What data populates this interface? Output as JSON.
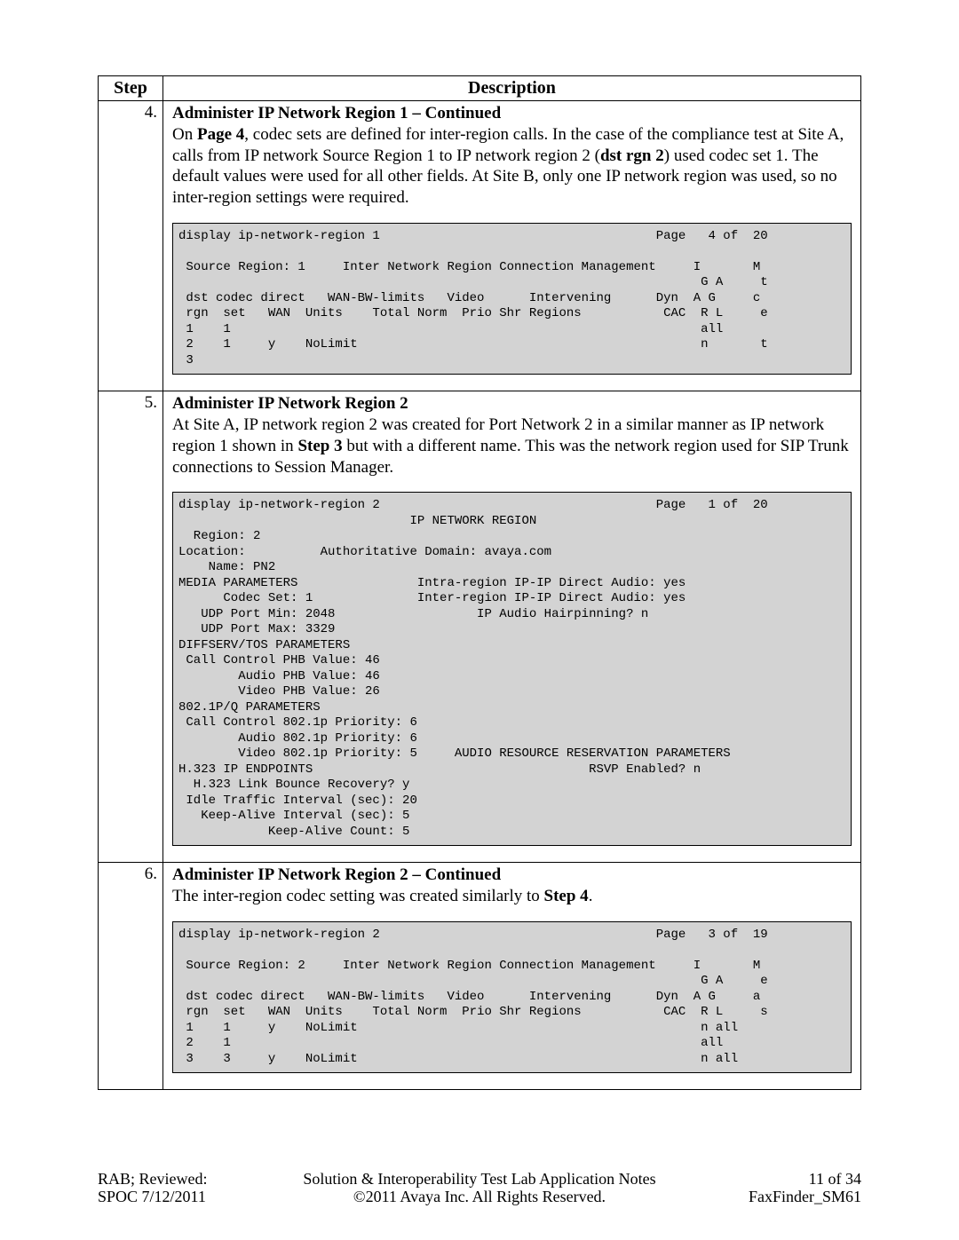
{
  "table": {
    "headers": {
      "step": "Step",
      "description": "Description"
    },
    "rows": [
      {
        "step": "4.",
        "title": "Administer IP Network Region 1 – Continued",
        "para_on": "On ",
        "para_page4": "Page 4",
        "para_mid1": ", codec sets are defined for inter-region calls. In the case of the compliance test at Site A, calls from IP network Source Region 1 to IP network region 2 (",
        "para_dstrgn": "dst rgn 2",
        "para_mid2": ") used codec set 1. The default values were used for all other fields. At Site B, only one IP network region was used, so no inter-region settings were required.",
        "code": "display ip-network-region 1                                     Page   4 of  20\n\n Source Region: 1     Inter Network Region Connection Management     I       M\n                                                                      G A     t\n dst codec direct   WAN-BW-limits   Video      Intervening      Dyn  A G     c\n rgn  set   WAN  Units    Total Norm  Prio Shr Regions           CAC  R L     e\n 1    1                                                               all\n 2    1     y    NoLimit                                              n       t\n 3"
      },
      {
        "step": "5.",
        "title": "Administer IP Network Region 2",
        "para_pre": "At Site A, IP network region 2 was created for Port Network 2 in a similar manner as IP network region 1 shown in ",
        "para_step3": "Step 3",
        "para_post": " but with a different name. This was the network region used for SIP Trunk connections to Session Manager.",
        "code": "display ip-network-region 2                                     Page   1 of  20\n                               IP NETWORK REGION\n  Region: 2\nLocation:          Authoritative Domain: avaya.com\n    Name: PN2\nMEDIA PARAMETERS                Intra-region IP-IP Direct Audio: yes\n      Codec Set: 1              Inter-region IP-IP Direct Audio: yes\n   UDP Port Min: 2048                   IP Audio Hairpinning? n\n   UDP Port Max: 3329\nDIFFSERV/TOS PARAMETERS\n Call Control PHB Value: 46\n        Audio PHB Value: 46\n        Video PHB Value: 26\n802.1P/Q PARAMETERS\n Call Control 802.1p Priority: 6\n        Audio 802.1p Priority: 6\n        Video 802.1p Priority: 5     AUDIO RESOURCE RESERVATION PARAMETERS\nH.323 IP ENDPOINTS                                     RSVP Enabled? n\n  H.323 Link Bounce Recovery? y\n Idle Traffic Interval (sec): 20\n   Keep-Alive Interval (sec): 5\n            Keep-Alive Count: 5"
      },
      {
        "step": "6.",
        "title": "Administer IP Network Region 2 – Continued",
        "para_pre": "The inter-region codec setting was created similarly to ",
        "para_step4": "Step 4",
        "para_post": ".",
        "code": "display ip-network-region 2                                     Page   3 of  19\n\n Source Region: 2     Inter Network Region Connection Management     I       M\n                                                                      G A     e\n dst codec direct   WAN-BW-limits   Video      Intervening      Dyn  A G     a\n rgn  set   WAN  Units    Total Norm  Prio Shr Regions           CAC  R L     s\n 1    1     y    NoLimit                                              n all\n 2    1                                                               all\n 3    3     y    NoLimit                                              n all"
      }
    ]
  },
  "footer": {
    "left1": "RAB; Reviewed:",
    "left2": "SPOC 7/12/2011",
    "center1": "Solution & Interoperability Test Lab Application Notes",
    "center2": "©2011 Avaya Inc. All Rights Reserved.",
    "right1": "11 of 34",
    "right2": "FaxFinder_SM61"
  }
}
